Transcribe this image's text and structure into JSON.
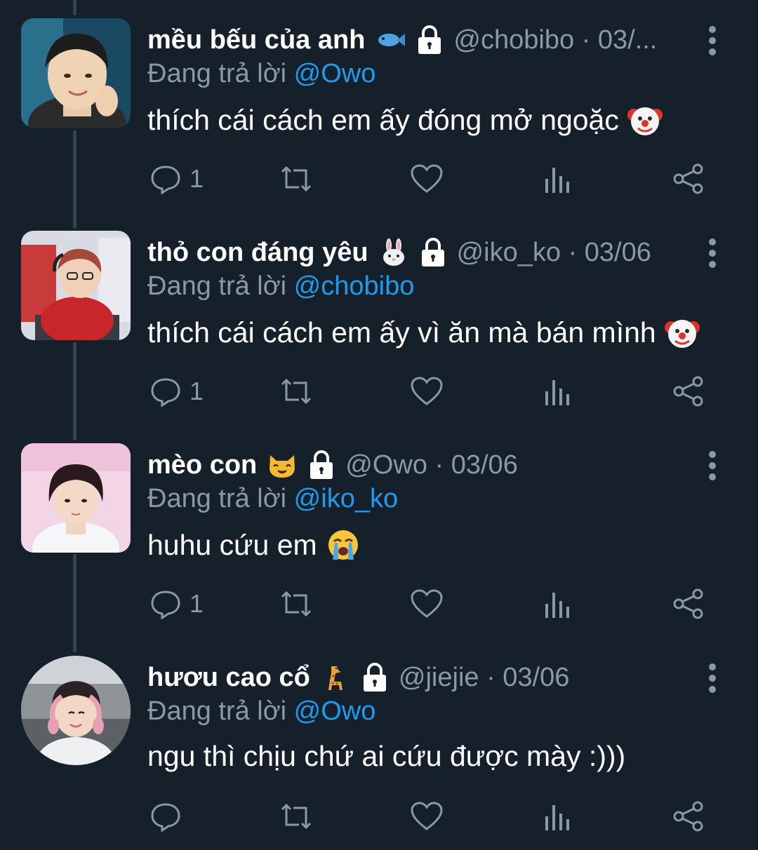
{
  "tweets": [
    {
      "name": "mều bếu của anh",
      "name_emoji": "fish-icon",
      "handle_meta": "@chobibo · 03/...",
      "reply_label": "Đang trả lời",
      "reply_to": "@Owo",
      "text": "thích cái cách em ấy đóng mở ngoặc",
      "text_emoji": "clown-face-icon",
      "reply_count": "1"
    },
    {
      "name": "thỏ con đáng yêu",
      "name_emoji": "rabbit-face-icon",
      "handle_meta": "@iko_ko · 03/06",
      "reply_label": "Đang trả lời",
      "reply_to": "@chobibo",
      "text": "thích cái cách em ấy vì ăn mà bán mình",
      "text_emoji": "clown-face-icon",
      "reply_count": "1"
    },
    {
      "name": "mèo con",
      "name_emoji": "cat-face-icon",
      "handle_meta": "@Owo · 03/06",
      "reply_label": "Đang trả lời",
      "reply_to": "@iko_ko",
      "text": "huhu cứu em",
      "text_emoji": "loudly-crying-face-icon",
      "reply_count": "1"
    },
    {
      "name": "hươu cao cổ",
      "name_emoji": "giraffe-icon",
      "handle_meta": "@jiejie · 03/06",
      "reply_label": "Đang trả lời",
      "reply_to": "@Owo",
      "text": "ngu thì chịu chứ ai cứu được mày :)))",
      "text_emoji": "",
      "reply_count": ""
    }
  ],
  "colors": {
    "background": "#15202b",
    "text_primary": "#ffffff",
    "text_secondary": "#8b98a5",
    "accent": "#1d9bf0",
    "thread_line": "#38444d"
  }
}
